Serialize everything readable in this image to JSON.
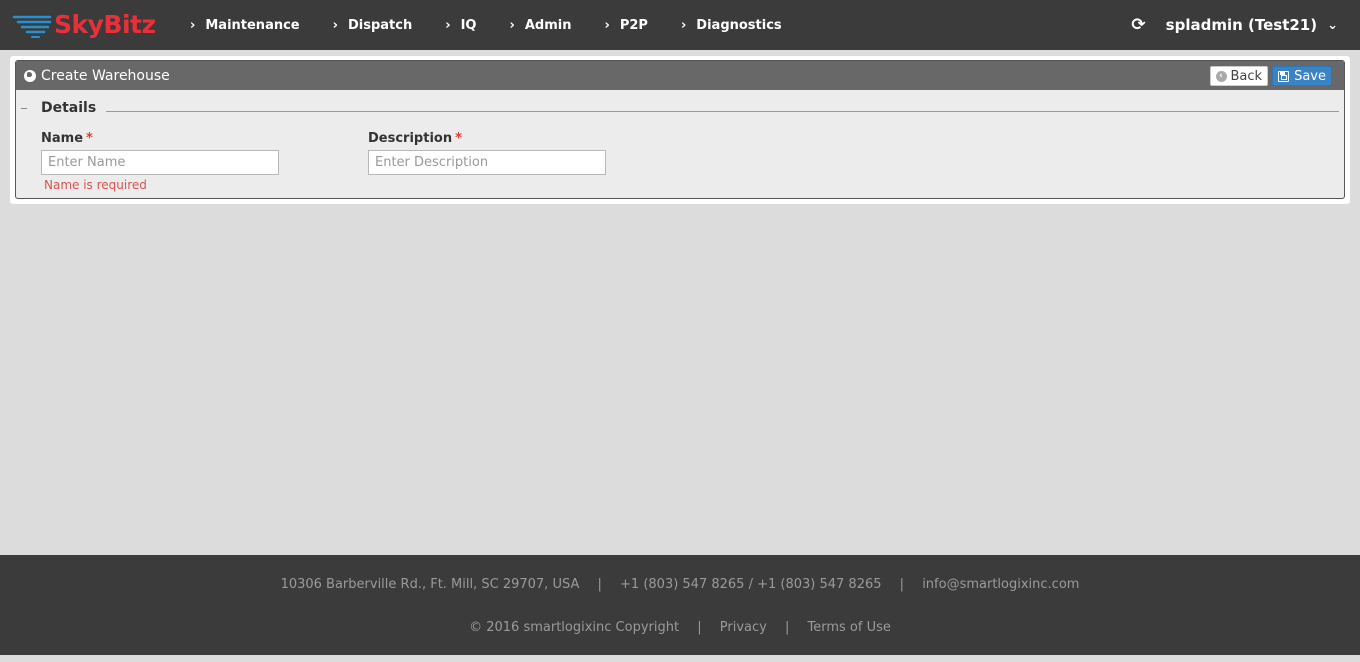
{
  "brand": {
    "name": "SkyBitz",
    "logo_color": "#e8303a"
  },
  "nav": {
    "items": [
      {
        "label": "Maintenance"
      },
      {
        "label": "Dispatch"
      },
      {
        "label": "IQ"
      },
      {
        "label": "Admin"
      },
      {
        "label": "P2P"
      },
      {
        "label": "Diagnostics"
      }
    ],
    "user_label": "spladmin (Test21)",
    "icons": {
      "refresh": "refresh-icon",
      "dropdown": "chevron-down-icon"
    }
  },
  "panel": {
    "title": "Create Warehouse",
    "back_label": "Back",
    "save_label": "Save",
    "section_legend": "Details",
    "name_label": "Name",
    "name_required_mark": "*",
    "name_placeholder": "Enter Name",
    "name_value": "",
    "name_error": "Name is required",
    "description_label": "Description",
    "description_required_mark": "*",
    "description_placeholder": "Enter Description",
    "description_value": ""
  },
  "footer": {
    "address": "10306 Barberville Rd., Ft. Mill, SC 29707, USA",
    "phones": "+1 (803) 547 8265 / +1 (803) 547 8265",
    "email": "info@smartlogixinc.com",
    "copyright": "© 2016 smartlogixinc Copyright",
    "privacy": "Privacy",
    "terms": "Terms of Use",
    "separator": "|"
  },
  "colors": {
    "navbar_bg": "#3b3b3b",
    "panel_header_bg": "#686868",
    "save_button": "#3a83c5",
    "error_text": "#d9534f"
  }
}
